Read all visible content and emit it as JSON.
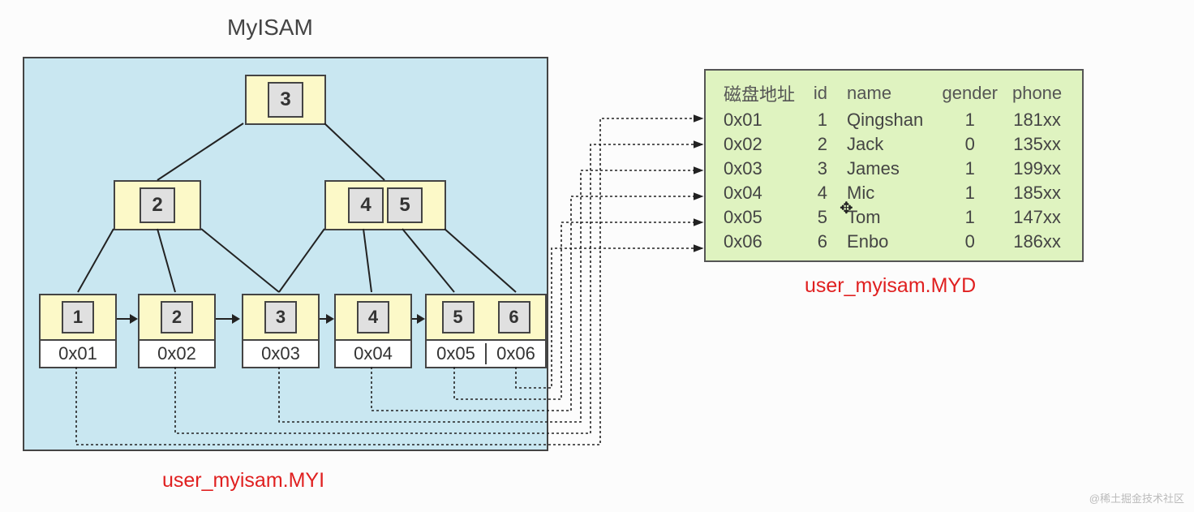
{
  "title": "MyISAM",
  "index_file_label": "user_myisam.MYI",
  "data_file_label": "user_myisam.MYD",
  "tree": {
    "root": {
      "keys": [
        "3"
      ]
    },
    "level2": [
      {
        "keys": [
          "2"
        ]
      },
      {
        "keys": [
          "4",
          "5"
        ]
      }
    ],
    "leaves": [
      {
        "keys": [
          "1"
        ],
        "addrs": [
          "0x01"
        ]
      },
      {
        "keys": [
          "2"
        ],
        "addrs": [
          "0x02"
        ]
      },
      {
        "keys": [
          "3"
        ],
        "addrs": [
          "0x03"
        ]
      },
      {
        "keys": [
          "4"
        ],
        "addrs": [
          "0x04"
        ]
      },
      {
        "keys": [
          "5",
          "6"
        ],
        "addrs": [
          "0x05",
          "0x06"
        ]
      }
    ]
  },
  "data_table": {
    "headers": [
      "磁盘地址",
      "id",
      "name",
      "gender",
      "phone"
    ],
    "rows": [
      {
        "addr": "0x01",
        "id": "1",
        "name": "Qingshan",
        "gender": "1",
        "phone": "181xx"
      },
      {
        "addr": "0x02",
        "id": "2",
        "name": "Jack",
        "gender": "0",
        "phone": "135xx"
      },
      {
        "addr": "0x03",
        "id": "3",
        "name": "James",
        "gender": "1",
        "phone": "199xx"
      },
      {
        "addr": "0x04",
        "id": "4",
        "name": "Mic",
        "gender": "1",
        "phone": "185xx"
      },
      {
        "addr": "0x05",
        "id": "5",
        "name": "Tom",
        "gender": "1",
        "phone": "147xx"
      },
      {
        "addr": "0x06",
        "id": "6",
        "name": "Enbo",
        "gender": "0",
        "phone": "186xx"
      }
    ]
  },
  "watermark": "@稀土掘金技术社区"
}
